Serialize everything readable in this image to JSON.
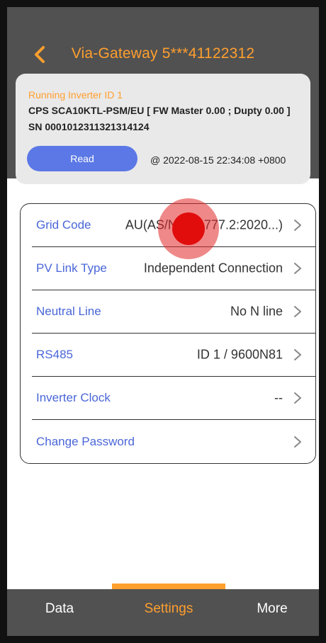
{
  "header": {
    "title": "Via-Gateway 5***41122312",
    "back_icon": "chevron-left-icon",
    "accent_color": "#ff9f2e"
  },
  "inverter_info": {
    "running_label": "Running Inverter ID 1",
    "model": "CPS SCA10KTL-PSM/EU [ FW Master 0.00 ; Dupty 0.00 ]",
    "serial": "SN 0001012311321314124",
    "read_label": "Read",
    "timestamp": "@ 2022-08-15 22:34:08 +0800"
  },
  "settings": {
    "rows": [
      {
        "label": "Grid Code",
        "value": "AU(AS/NZS 4777.2:2020...)"
      },
      {
        "label": "PV Link Type",
        "value": "Independent Connection"
      },
      {
        "label": "Neutral Line",
        "value": "No N line"
      },
      {
        "label": "RS485",
        "value": "ID 1 / 9600N81"
      },
      {
        "label": "Inverter Clock",
        "value": "--"
      },
      {
        "label": "Change Password",
        "value": ""
      }
    ],
    "chevron_icon": "chevron-right-icon"
  },
  "tabbar": {
    "tabs": [
      {
        "label": "Data"
      },
      {
        "label": "Settings"
      },
      {
        "label": "More"
      }
    ],
    "active": "Settings"
  }
}
